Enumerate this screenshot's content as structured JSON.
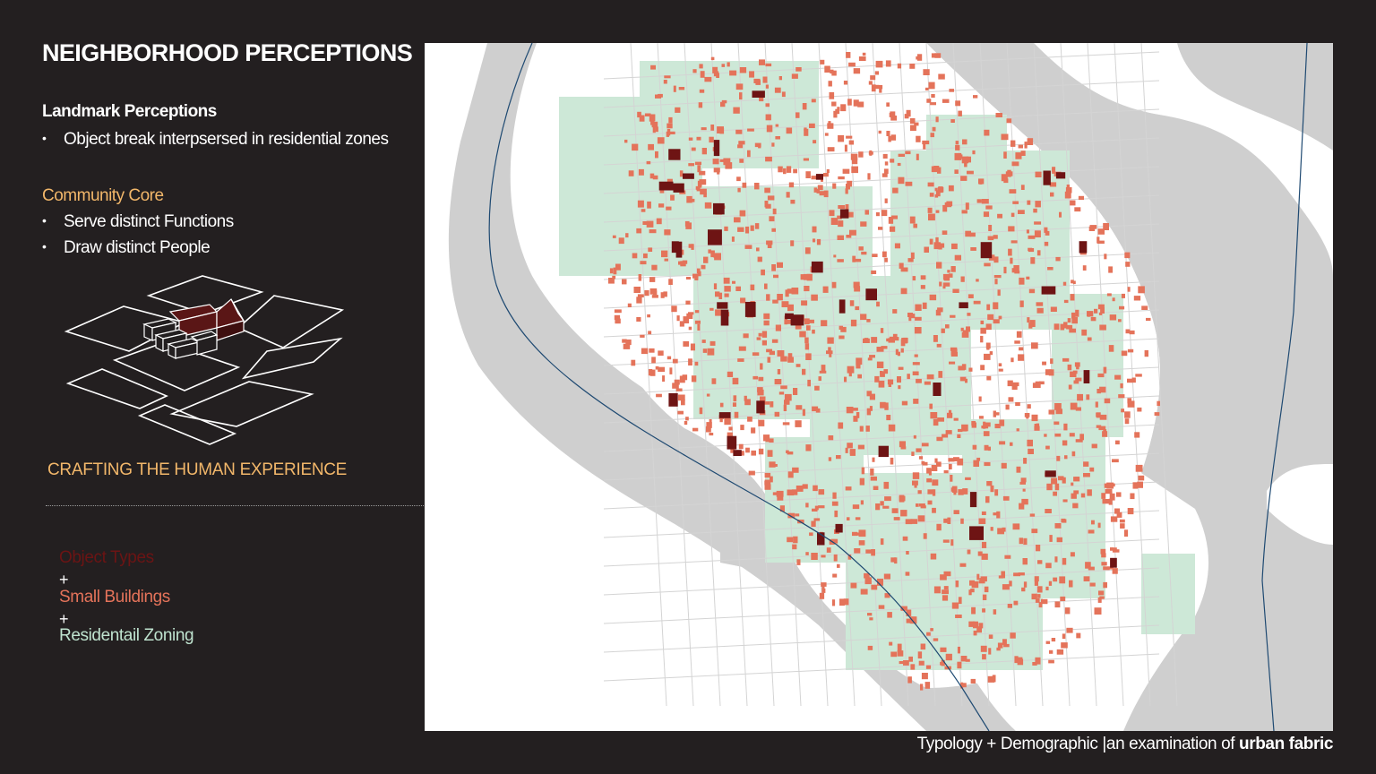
{
  "colors": {
    "background": "#231f20",
    "core_heading": "#f2b76a",
    "object_types": "#6b1414",
    "small_buildings": "#e4735a",
    "residential": "#bfe3cf",
    "map_water": "#cfcfcf",
    "map_land": "#ffffff",
    "map_residential_zone": "#cde8d7",
    "map_small_building": "#e4735a",
    "map_object": "#6e1414",
    "map_boundary": "#1f4a72"
  },
  "slide": {
    "title": "NEIGHBORHOOD PERCEPTIONS",
    "landmark_heading": "Landmark Perceptions",
    "landmark_bullets": [
      "Object break interpsersed in residential zones"
    ],
    "core_heading": "Community Core",
    "core_bullets": [
      "Serve distinct Functions",
      "Draw distinct People"
    ],
    "bullet_symbol": "•",
    "tagline": "CRAFTING THE HUMAN EXPERIENCE"
  },
  "legend": {
    "object_types": "Object Types",
    "plus": "+",
    "small_buildings": "Small Buildings",
    "residential_zoning": "Residentail Zoning"
  },
  "footer": {
    "prefix": "Typology + Demographic",
    "separator": "|",
    "middle": "an examination of",
    "strong": "urban fabric"
  },
  "icons": {
    "diagram": "isometric-block-icon",
    "map": "city-map-icon"
  }
}
